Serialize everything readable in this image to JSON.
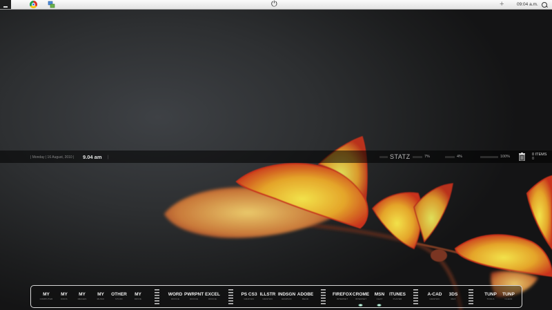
{
  "menubar": {
    "icons": [
      "chrome-icon",
      "network-icon",
      "power-icon",
      "plus-icon",
      "search-icon"
    ],
    "clock": "09:04 a.m."
  },
  "infobar": {
    "date": "|  Monday  |  16 August, 2010  |",
    "time": "9.04 am",
    "time_sep": "|",
    "statz_label": "STATZ",
    "stat1": "7%",
    "stat2": "4%",
    "stat3": "100%",
    "items_count": "0 ITEMS",
    "items_sub": "0"
  },
  "dock": {
    "items": [
      {
        "label": "MY",
        "sub": "COMPUTER"
      },
      {
        "label": "MY",
        "sub": "DOCS"
      },
      {
        "label": "MY",
        "sub": "IMAGES"
      },
      {
        "label": "MY",
        "sub": "MUSIC"
      },
      {
        "label": "OTHER",
        "sub": "STUFF"
      },
      {
        "label": "MY",
        "sub": "DRIVE"
      },
      {
        "label": "WORD",
        "sub": "OFFICE"
      },
      {
        "label": "PWRPNT",
        "sub": "OFFICE"
      },
      {
        "label": "EXCEL",
        "sub": "OFFICE"
      },
      {
        "label": "PS CS3",
        "sub": "GRAPHIC"
      },
      {
        "label": "ILLSTR",
        "sub": "GRAPHIC"
      },
      {
        "label": "INDSGN",
        "sub": "GRAPHIC"
      },
      {
        "label": "ADOBE",
        "sub": "READ"
      },
      {
        "label": "FIREFOX",
        "sub": "INTERNET"
      },
      {
        "label": "CROME",
        "sub": "INTERNET"
      },
      {
        "label": "MSN",
        "sub": "CHAT"
      },
      {
        "label": "ITUNES",
        "sub": "PLAYER"
      },
      {
        "label": "A-CAD",
        "sub": "GRAPHIC"
      },
      {
        "label": "3DS",
        "sub": "MAX"
      },
      {
        "label": "TUNP",
        "sub": "TOOLS"
      },
      {
        "label": "TUNP",
        "sub": "CLEAN"
      }
    ],
    "running": [
      "CROME",
      "MSN"
    ]
  },
  "colors": {
    "leaf_yellow": "#e8c23a",
    "leaf_red": "#c8321c",
    "dock_border": "#d8d8d8"
  }
}
